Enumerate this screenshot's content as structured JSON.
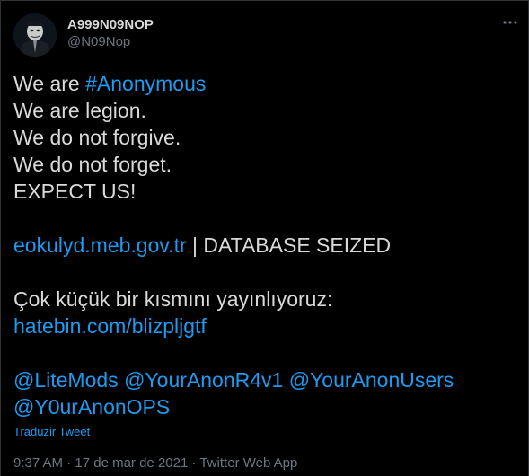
{
  "author": {
    "display_name": "A999N09NOP",
    "handle": "@N09Nop",
    "avatar_icon": "anonymous-mask-avatar"
  },
  "more_icon": "ellipsis-icon",
  "tweet": {
    "line1_prefix": "We are ",
    "line1_hashtag": "#Anonymous",
    "line2": "We are legion.",
    "line3": "We do not forgive.",
    "line4": "We do not forget.",
    "line5": "EXPECT US!",
    "line6_link": "eokulyd.meb.gov.tr",
    "line6_rest": " | DATABASE SEIZED",
    "line7": "Çok küçük bir kısmını yayınlıyoruz:",
    "line8_link": "hatebin.com/blizpljgtf",
    "mentions_line1": [
      "@LiteMods",
      "@YourAnonR4v1",
      "@YourAnonUsers"
    ],
    "mentions_line2": [
      "@Y0urAnonOPS"
    ]
  },
  "translate_label": "Traduzir Tweet",
  "meta": {
    "time": "9:37 AM",
    "separator": " · ",
    "date": "17 de mar de 2021",
    "source": "Twitter Web App"
  },
  "colors": {
    "background": "#000000",
    "text": "#d9d9d9",
    "link": "#1d9bf0",
    "muted": "#6e767d"
  }
}
